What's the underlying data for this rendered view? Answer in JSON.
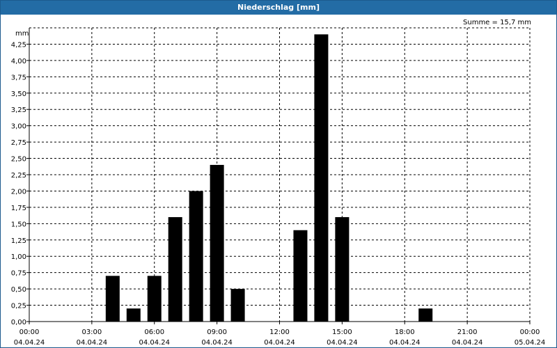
{
  "chart_data": {
    "type": "bar",
    "title": "Niederschlag [mm]",
    "ylabel": "mm",
    "summary": "Summe = 15,7 mm",
    "ylim": [
      0,
      4.5
    ],
    "y_ticks": [
      "0,00",
      "0,25",
      "0,50",
      "0,75",
      "1,00",
      "1,25",
      "1,50",
      "1,75",
      "2,00",
      "2,25",
      "2,50",
      "2,75",
      "3,00",
      "3,25",
      "3,50",
      "3,75",
      "4,00",
      "4,25"
    ],
    "x_ticks": [
      {
        "time": "00:00",
        "date": "04.04.24"
      },
      {
        "time": "03:00",
        "date": "04.04.24"
      },
      {
        "time": "06:00",
        "date": "04.04.24"
      },
      {
        "time": "09:00",
        "date": "04.04.24"
      },
      {
        "time": "12:00",
        "date": "04.04.24"
      },
      {
        "time": "15:00",
        "date": "04.04.24"
      },
      {
        "time": "18:00",
        "date": "04.04.24"
      },
      {
        "time": "21:00",
        "date": "04.04.24"
      },
      {
        "time": "00:00",
        "date": "05.04.24"
      }
    ],
    "categories": [
      "04.04.24 04:00",
      "04.04.24 05:00",
      "04.04.24 06:00",
      "04.04.24 07:00",
      "04.04.24 08:00",
      "04.04.24 09:00",
      "04.04.24 10:00",
      "04.04.24 13:00",
      "04.04.24 14:00",
      "04.04.24 15:00",
      "04.04.24 19:00"
    ],
    "values": [
      0.7,
      0.2,
      0.7,
      1.6,
      2.0,
      2.4,
      0.5,
      1.4,
      4.4,
      1.6,
      0.2
    ],
    "grid": true
  },
  "colors": {
    "title_bar": "#236ca5",
    "bar": "#000000",
    "grid": "#000000"
  }
}
